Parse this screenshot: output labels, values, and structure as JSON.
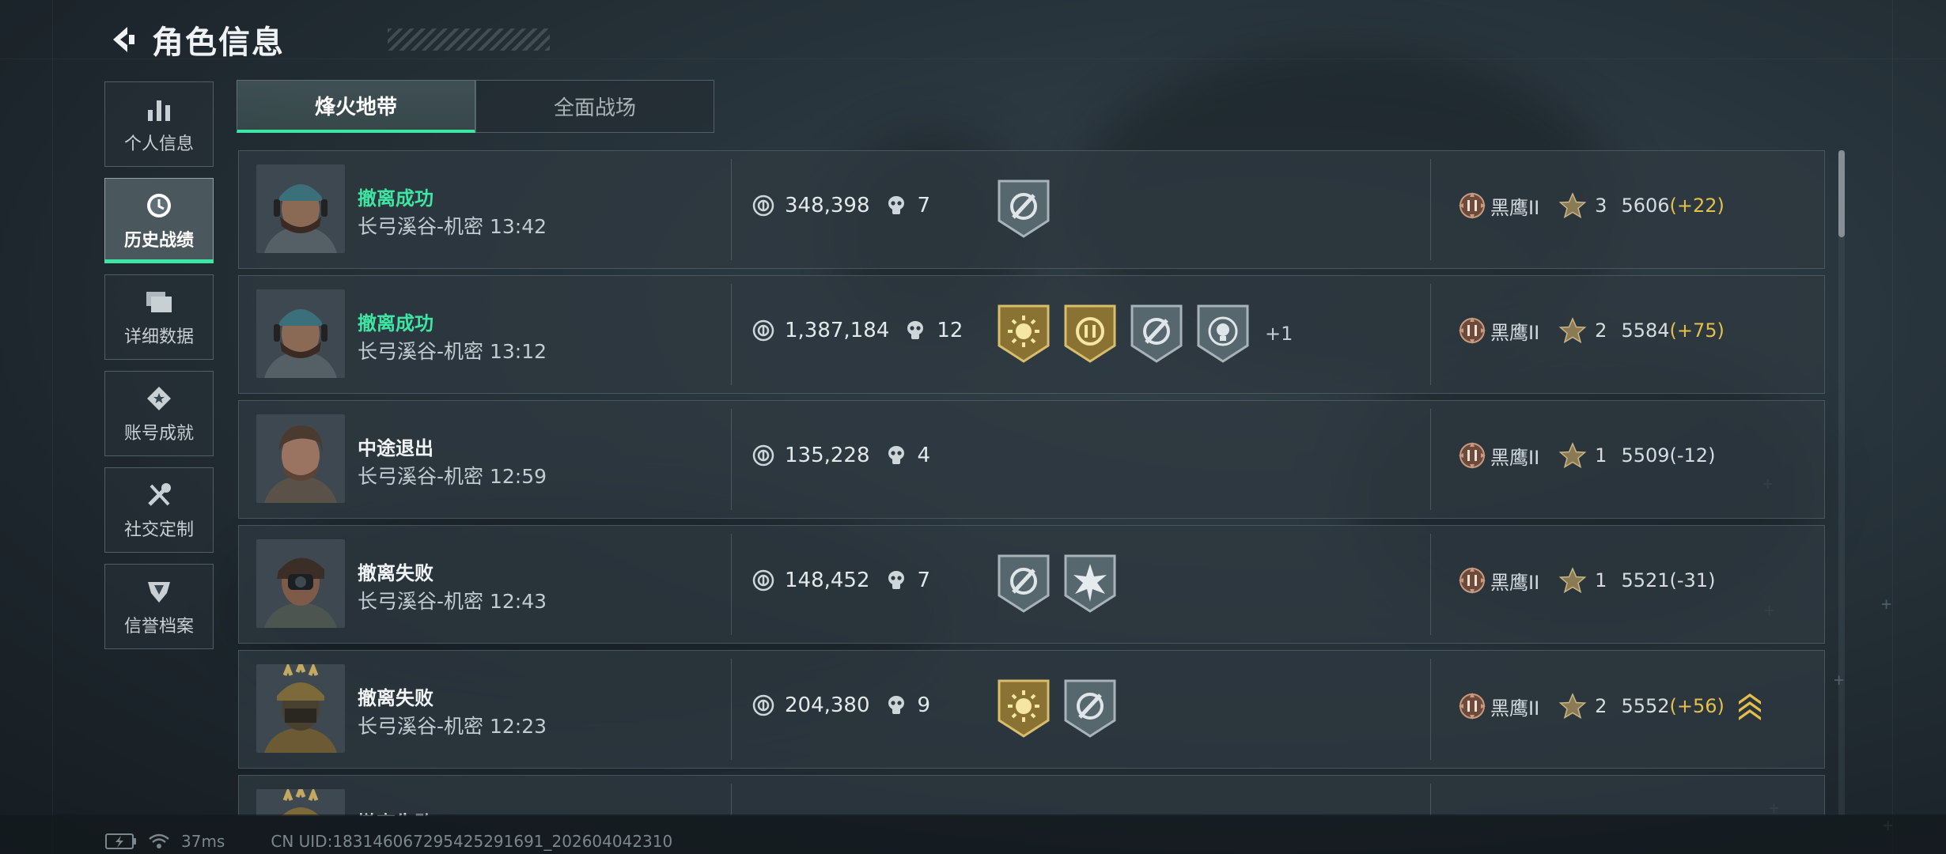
{
  "header": {
    "title": "角色信息"
  },
  "sidebar": {
    "items": [
      {
        "label": "个人信息",
        "icon": "bar-chart-icon",
        "active": false
      },
      {
        "label": "历史战绩",
        "icon": "clock-icon",
        "active": true
      },
      {
        "label": "详细数据",
        "icon": "folder-stack-icon",
        "active": false
      },
      {
        "label": "账号成就",
        "icon": "achievement-icon",
        "active": false
      },
      {
        "label": "社交定制",
        "icon": "tools-icon",
        "active": false
      },
      {
        "label": "信誉档案",
        "icon": "shield-emblem-icon",
        "active": false
      }
    ]
  },
  "tabs": [
    {
      "label": "烽火地带",
      "active": true
    },
    {
      "label": "全面战场",
      "active": false
    }
  ],
  "matches": [
    {
      "status": "撤离成功",
      "success": true,
      "map": "长弓溪谷-机密",
      "time": "13:42",
      "value": "348,398",
      "kills": "7",
      "medals": [
        "silver-target"
      ],
      "more": "",
      "rank": "黑鹰II",
      "stars": "3",
      "score": "5606",
      "delta": "(+22)",
      "delta_up": true,
      "promo": false
    },
    {
      "status": "撤离成功",
      "success": true,
      "map": "长弓溪谷-机密",
      "time": "13:12",
      "value": "1,387,184",
      "kills": "12",
      "medals": [
        "gold-sun",
        "gold-coin",
        "silver-target",
        "silver-skull"
      ],
      "more": "+1",
      "rank": "黑鹰II",
      "stars": "2",
      "score": "5584",
      "delta": "(+75)",
      "delta_up": true,
      "promo": false
    },
    {
      "status": "中途退出",
      "success": false,
      "map": "长弓溪谷-机密",
      "time": "12:59",
      "value": "135,228",
      "kills": "4",
      "medals": [],
      "more": "",
      "rank": "黑鹰II",
      "stars": "1",
      "score": "5509",
      "delta": "(-12)",
      "delta_up": false,
      "promo": false
    },
    {
      "status": "撤离失败",
      "success": false,
      "map": "长弓溪谷-机密",
      "time": "12:43",
      "value": "148,452",
      "kills": "7",
      "medals": [
        "silver-target",
        "silver-burst"
      ],
      "more": "",
      "rank": "黑鹰II",
      "stars": "1",
      "score": "5521",
      "delta": "(-31)",
      "delta_up": false,
      "promo": false
    },
    {
      "status": "撤离失败",
      "success": false,
      "map": "长弓溪谷-机密",
      "time": "12:23",
      "value": "204,380",
      "kills": "9",
      "medals": [
        "gold-sun",
        "silver-target"
      ],
      "more": "",
      "rank": "黑鹰II",
      "stars": "2",
      "score": "5552",
      "delta": "(+56)",
      "delta_up": true,
      "promo": true
    },
    {
      "status": "撤离失败",
      "success": false,
      "map": "",
      "time": "",
      "value": "",
      "kills": "",
      "medals": [],
      "more": "",
      "rank": "",
      "stars": "",
      "score": "",
      "delta": "",
      "delta_up": false,
      "promo": false
    }
  ],
  "footer": {
    "ping": "37ms",
    "uid": "CN UID:183146067295425291691_202604042310"
  },
  "colors": {
    "accent": "#3ee6a4",
    "gold": "#e3c04a",
    "panel": "#2e3940"
  }
}
